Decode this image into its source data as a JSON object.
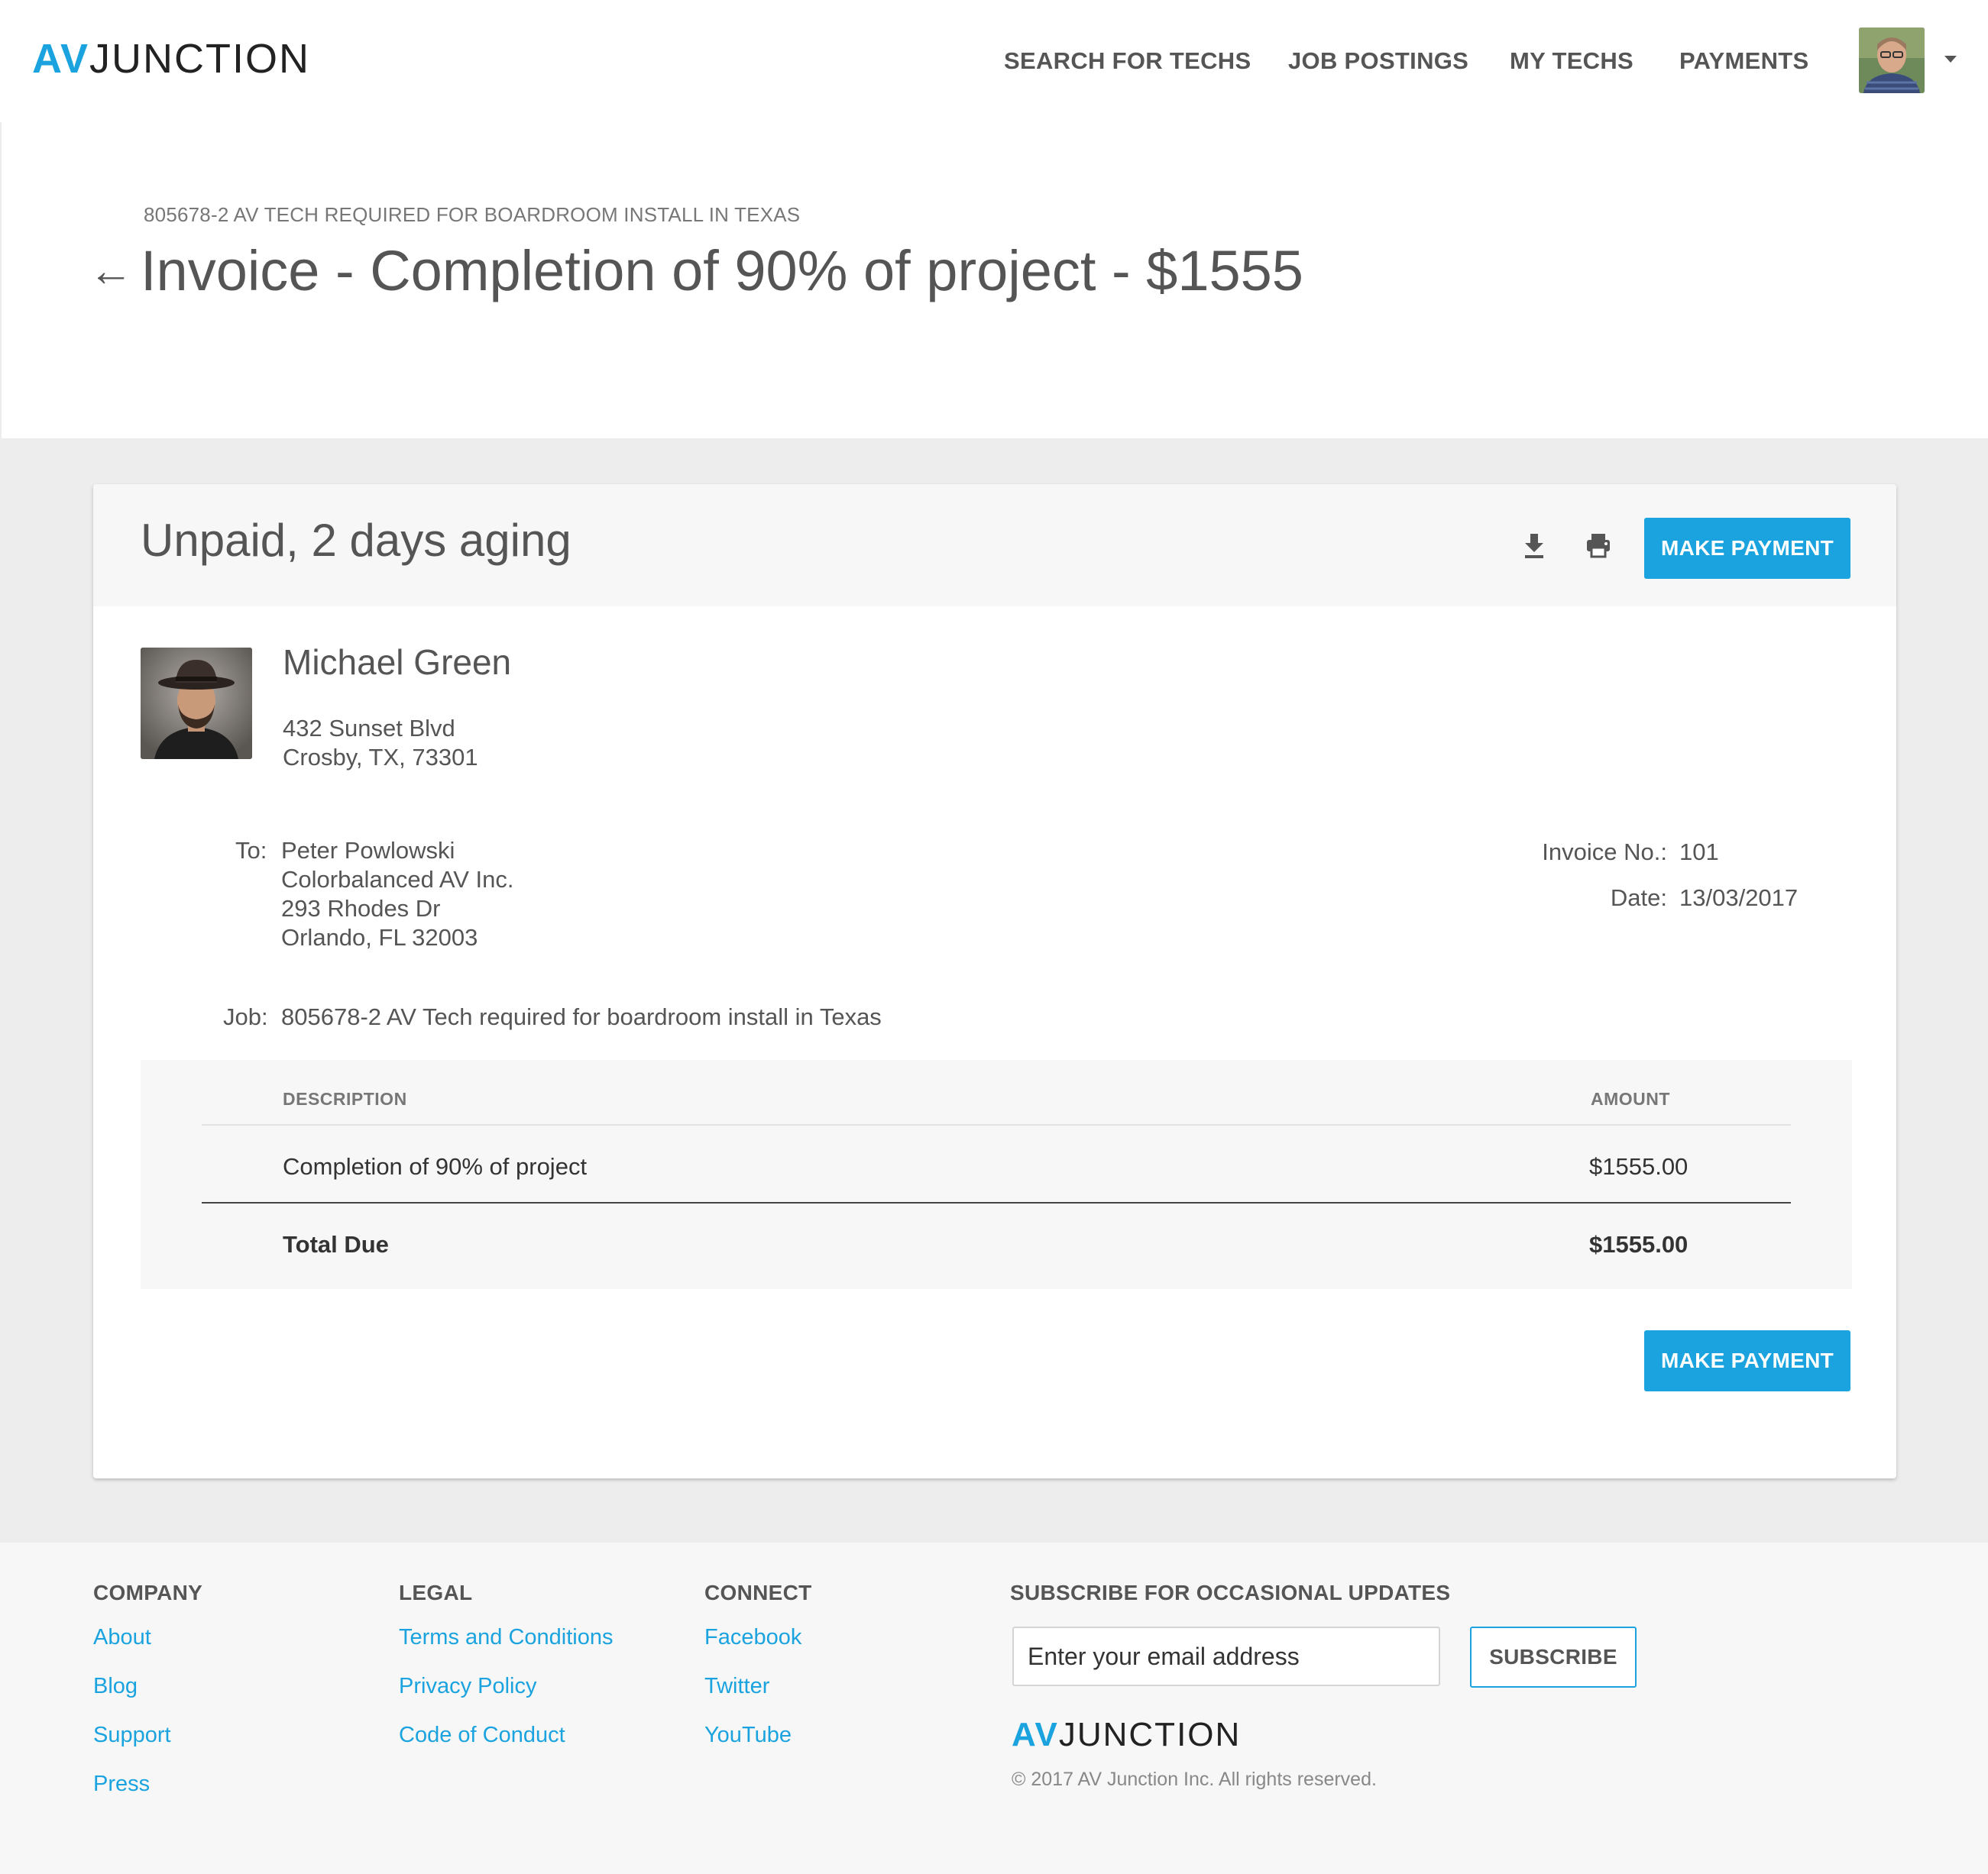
{
  "brand": {
    "logo_av": "AV",
    "logo_rest": "JUNCTION",
    "accent_color": "#1aa3de"
  },
  "nav": {
    "items": [
      {
        "label": "SEARCH FOR TECHS"
      },
      {
        "label": "JOB POSTINGS"
      },
      {
        "label": "MY TECHS"
      },
      {
        "label": "PAYMENTS"
      }
    ],
    "avatar_icon": "user-avatar",
    "menu_icon": "caret-down-icon"
  },
  "page": {
    "breadcrumb": "805678-2 AV TECH REQUIRED FOR BOARDROOM INSTALL IN TEXAS",
    "back_icon": "←",
    "title": "Invoice - Completion of 90% of project - $1555"
  },
  "invoice": {
    "status": "Unpaid, 2 days aging",
    "download_icon": "download-icon",
    "print_icon": "print-icon",
    "make_payment_label": "MAKE PAYMENT",
    "from": {
      "name": "Michael Green",
      "address_line1": "432 Sunset Blvd",
      "address_line2": "Crosby, TX, 73301"
    },
    "to": {
      "label": "To:",
      "name": "Peter Powlowski",
      "company": "Colorbalanced AV Inc.",
      "address_line1": "293 Rhodes Dr",
      "address_line2": "Orlando, FL 32003"
    },
    "invoice_no_label": "Invoice No.:",
    "invoice_no": "101",
    "date_label": "Date:",
    "date": "13/03/2017",
    "job_label": "Job:",
    "job": "805678-2 AV Tech required for boardroom install in Texas",
    "table": {
      "col_description": "DESCRIPTION",
      "col_amount": "AMOUNT",
      "rows": [
        {
          "description": "Completion of 90% of project",
          "amount": "$1555.00"
        }
      ],
      "total_label": "Total Due",
      "total_amount": "$1555.00"
    }
  },
  "footer": {
    "company": {
      "heading": "COMPANY",
      "links": [
        "About",
        "Blog",
        "Support",
        "Press"
      ]
    },
    "legal": {
      "heading": "LEGAL",
      "links": [
        "Terms and Conditions",
        "Privacy Policy",
        "Code of Conduct"
      ]
    },
    "connect": {
      "heading": "CONNECT",
      "links": [
        "Facebook",
        "Twitter",
        "YouTube"
      ]
    },
    "subscribe": {
      "heading": "SUBSCRIBE FOR OCCASIONAL UPDATES",
      "placeholder": "Enter your email address",
      "button_label": "SUBSCRIBE"
    },
    "copyright": "© 2017 AV Junction Inc. All rights reserved."
  }
}
